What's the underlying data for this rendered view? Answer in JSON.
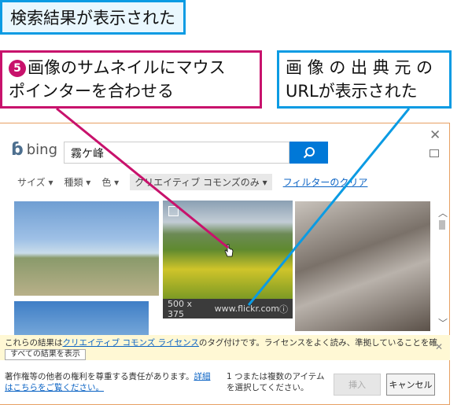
{
  "callouts": {
    "top": "検索結果が表示された",
    "step_number": "5",
    "pink_line1": "画像のサムネイルにマウス",
    "pink_line2": "ポインターを合わせる",
    "blue_line1": "画 像 の 出 典 元 の",
    "blue_line2": "URLが表示された"
  },
  "dialog": {
    "logo_text": "bing",
    "search_value": "霧ケ峰",
    "filters": [
      "サイズ ▾",
      "種類 ▾",
      "色 ▾"
    ],
    "active_filter": "クリエイティブ コモンズのみ ▾",
    "clear_filter": "フィルターのクリア",
    "hover_image": {
      "size": "500 x 375",
      "source": "www.flickr.com",
      "info": "ⓘ"
    },
    "notice": {
      "before_link": "これらの結果は",
      "link": "クリエイティブ コモンズ ライセンス",
      "after_link": "のタグ付けです。ライセンスをよく読み、準拠していることを確認してください。",
      "show_all": "すべての結果を表示",
      "close": "✕"
    },
    "footer": {
      "responsibility": "著作権等の他者の権利を尊重する責任があります。",
      "details_link": "詳細はこちらをご覧ください。",
      "selection_note": "1 つまたは複数のアイテムを選択してください。",
      "insert_label": "挿入",
      "cancel_label": "キャンセル"
    },
    "close_label": "✕"
  },
  "colors": {
    "accent": "#0078d7",
    "callout_blue": "#0b9be3",
    "callout_pink": "#c8126c"
  }
}
